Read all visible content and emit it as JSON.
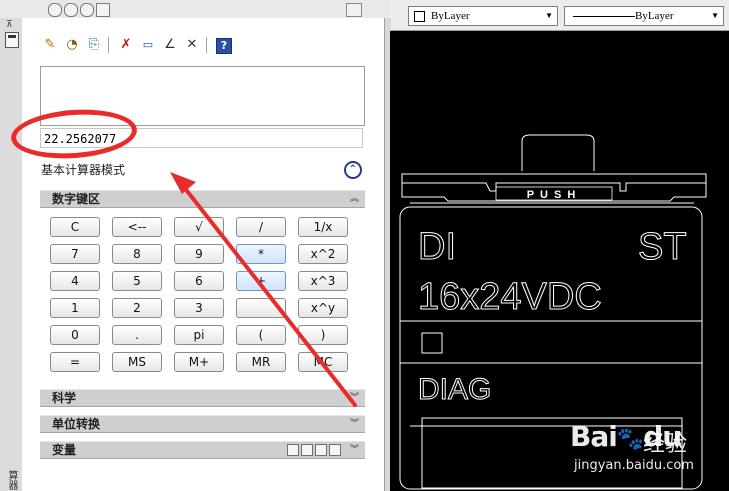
{
  "top_toolbar": {
    "combo_layer": "ByLayer",
    "combo_linetype": "ByLayer"
  },
  "side_strip": {
    "vertical_label": "算器"
  },
  "calculator": {
    "input_value": "22.2562077",
    "mode_label": "基本计算器模式",
    "mode_toggle": "⌃",
    "keypad_title": "数字键区",
    "keys": [
      [
        "C",
        "<--",
        "√",
        "/",
        "1/x"
      ],
      [
        "7",
        "8",
        "9",
        "*",
        "x^2"
      ],
      [
        "4",
        "5",
        "6",
        "+",
        "x^3"
      ],
      [
        "1",
        "2",
        "3",
        "",
        "x^y"
      ],
      [
        "0",
        ".",
        "pi",
        "(",
        ")"
      ],
      [
        "=",
        "MS",
        "M+",
        "MR",
        "MC"
      ]
    ],
    "sections": {
      "science": "科学",
      "unit": "单位转换",
      "variables": "变量"
    },
    "section_chevrons": {
      "expanded": "︽",
      "collapsed": "︾"
    }
  },
  "cad_drawing": {
    "label_di": "DI",
    "label_st": "ST",
    "label_voltage": "16x24VDC",
    "label_diag": "DIAG",
    "label_push": "PUSH"
  },
  "watermark": {
    "brand": "Bai",
    "brand_tail": "du",
    "cn_text": "经验",
    "url": "jingyan.baidu.com"
  },
  "colors": {
    "annotation": "#ea2b2b",
    "cad_background": "#000000",
    "cad_lines": "#ffffff"
  }
}
